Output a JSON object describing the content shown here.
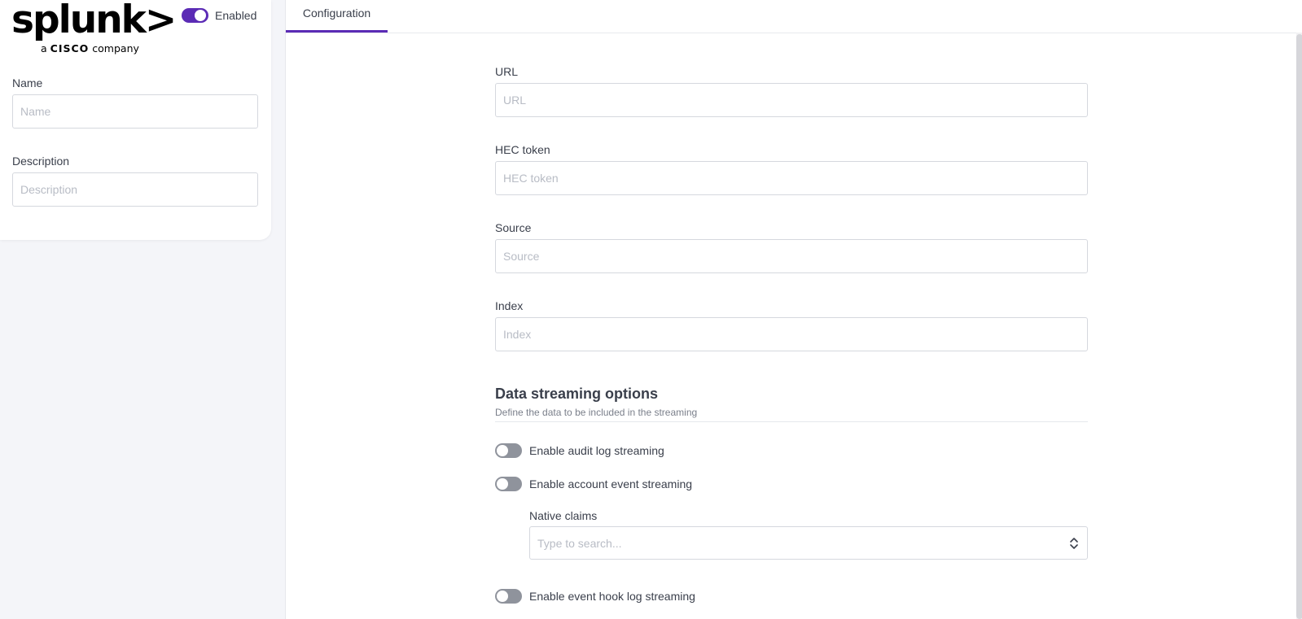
{
  "logo": {
    "wordmark": "splunk>",
    "tagline_prefix": "a",
    "tagline_brand": "CISCO",
    "tagline_suffix": "company"
  },
  "status": {
    "enabled_label": "Enabled",
    "enabled": true
  },
  "sidebar": {
    "name": {
      "label": "Name",
      "placeholder": "Name",
      "value": ""
    },
    "description": {
      "label": "Description",
      "placeholder": "Description",
      "value": ""
    }
  },
  "tabs": [
    {
      "label": "Configuration",
      "active": true
    }
  ],
  "form": {
    "url": {
      "label": "URL",
      "placeholder": "URL",
      "value": ""
    },
    "hec_token": {
      "label": "HEC token",
      "placeholder": "HEC token",
      "value": ""
    },
    "source": {
      "label": "Source",
      "placeholder": "Source",
      "value": ""
    },
    "index": {
      "label": "Index",
      "placeholder": "Index",
      "value": ""
    }
  },
  "streaming": {
    "title": "Data streaming options",
    "subtitle": "Define the data to be included in the streaming",
    "audit_log": {
      "label": "Enable audit log streaming",
      "enabled": false
    },
    "account_event": {
      "label": "Enable account event streaming",
      "enabled": false
    },
    "native_claims": {
      "label": "Native claims",
      "placeholder": "Type to search..."
    },
    "event_hook": {
      "label": "Enable event hook log streaming",
      "enabled": false
    }
  },
  "colors": {
    "accent": "#5b2bb5",
    "switch_off": "#8f939c",
    "background": "#f4f5f9"
  }
}
